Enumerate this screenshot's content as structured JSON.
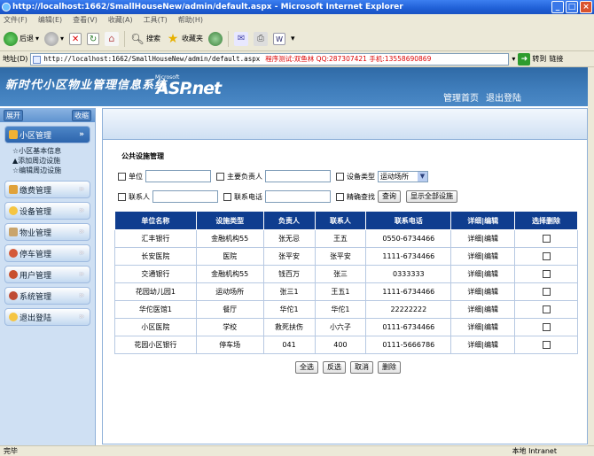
{
  "window": {
    "title": "http://localhost:1662/SmallHouseNew/admin/default.aspx - Microsoft Internet Explorer",
    "buttons": [
      "_",
      "□",
      "×"
    ]
  },
  "menu": [
    "文件(F)",
    "编辑(E)",
    "查看(V)",
    "收藏(A)",
    "工具(T)",
    "帮助(H)"
  ],
  "toolbar": {
    "back": "后退",
    "search": "搜索",
    "favorites": "收藏夹"
  },
  "address": {
    "label": "地址(D)",
    "url": "http://localhost:1662/SmallHouseNew/admin/default.aspx",
    "note": "程序测试:双鱼林 QQ:287307421 手机:13558690869",
    "go": "转到",
    "links": "链接"
  },
  "banner": {
    "title": "新时代小区物业管理信息系统",
    "logo_small": "Microsoft",
    "logo": "ASP.net",
    "nav": [
      "管理首页",
      "退出登陆"
    ]
  },
  "sidebar": {
    "expand": "展开",
    "collapse": "收缩",
    "items": [
      {
        "label": "小区管理",
        "active": true,
        "sub": [
          "☆小区基本信息",
          "▲添加周边设施",
          "☆编辑周边设施"
        ]
      },
      {
        "label": "缴费管理",
        "active": false
      },
      {
        "label": "设备管理",
        "active": false
      },
      {
        "label": "物业管理",
        "active": false
      },
      {
        "label": "停车管理",
        "active": false
      },
      {
        "label": "用户管理",
        "active": false
      },
      {
        "label": "系统管理",
        "active": false
      },
      {
        "label": "退出登陆",
        "active": false
      }
    ]
  },
  "panel": {
    "title": "公共设施管理",
    "filters": {
      "unit": "单位",
      "owner": "主要负责人",
      "type": "设备类型",
      "type_value": "运动场所",
      "contact": "联系人",
      "phone": "联系电话",
      "exact": "精确查找",
      "query": "查询",
      "show_all": "显示全部设施"
    },
    "table": {
      "headers": [
        "单位名称",
        "设施类型",
        "负责人",
        "联系人",
        "联系电话",
        "详细|编辑",
        "选择删除"
      ],
      "rows": [
        [
          "汇丰银行",
          "金融机构55",
          "张无忌",
          "王五",
          "0550-6734466",
          "详细|编辑"
        ],
        [
          "长安医院",
          "医院",
          "张平安",
          "张平安",
          "1111-6734466",
          "详细|编辑"
        ],
        [
          "交通银行",
          "金融机构55",
          "钱百万",
          "张三",
          "0333333",
          "详细|编辑"
        ],
        [
          "花园幼儿园1",
          "运动场所",
          "张三1",
          "王五1",
          "1111-6734466",
          "详细|编辑"
        ],
        [
          "华佗医馆1",
          "餐厅",
          "华佗1",
          "华佗1",
          "22222222",
          "详细|编辑"
        ],
        [
          "小区医院",
          "学校",
          "救死扶伤",
          "小六子",
          "0111-6734466",
          "详细|编辑"
        ],
        [
          "花园小区银行",
          "停车场",
          "041",
          "400",
          "0111-5666786",
          "详细|编辑"
        ]
      ]
    },
    "actions": [
      "全选",
      "反选",
      "取消",
      "删除"
    ]
  },
  "status": {
    "left": "完毕",
    "right": "本地 Intranet"
  }
}
